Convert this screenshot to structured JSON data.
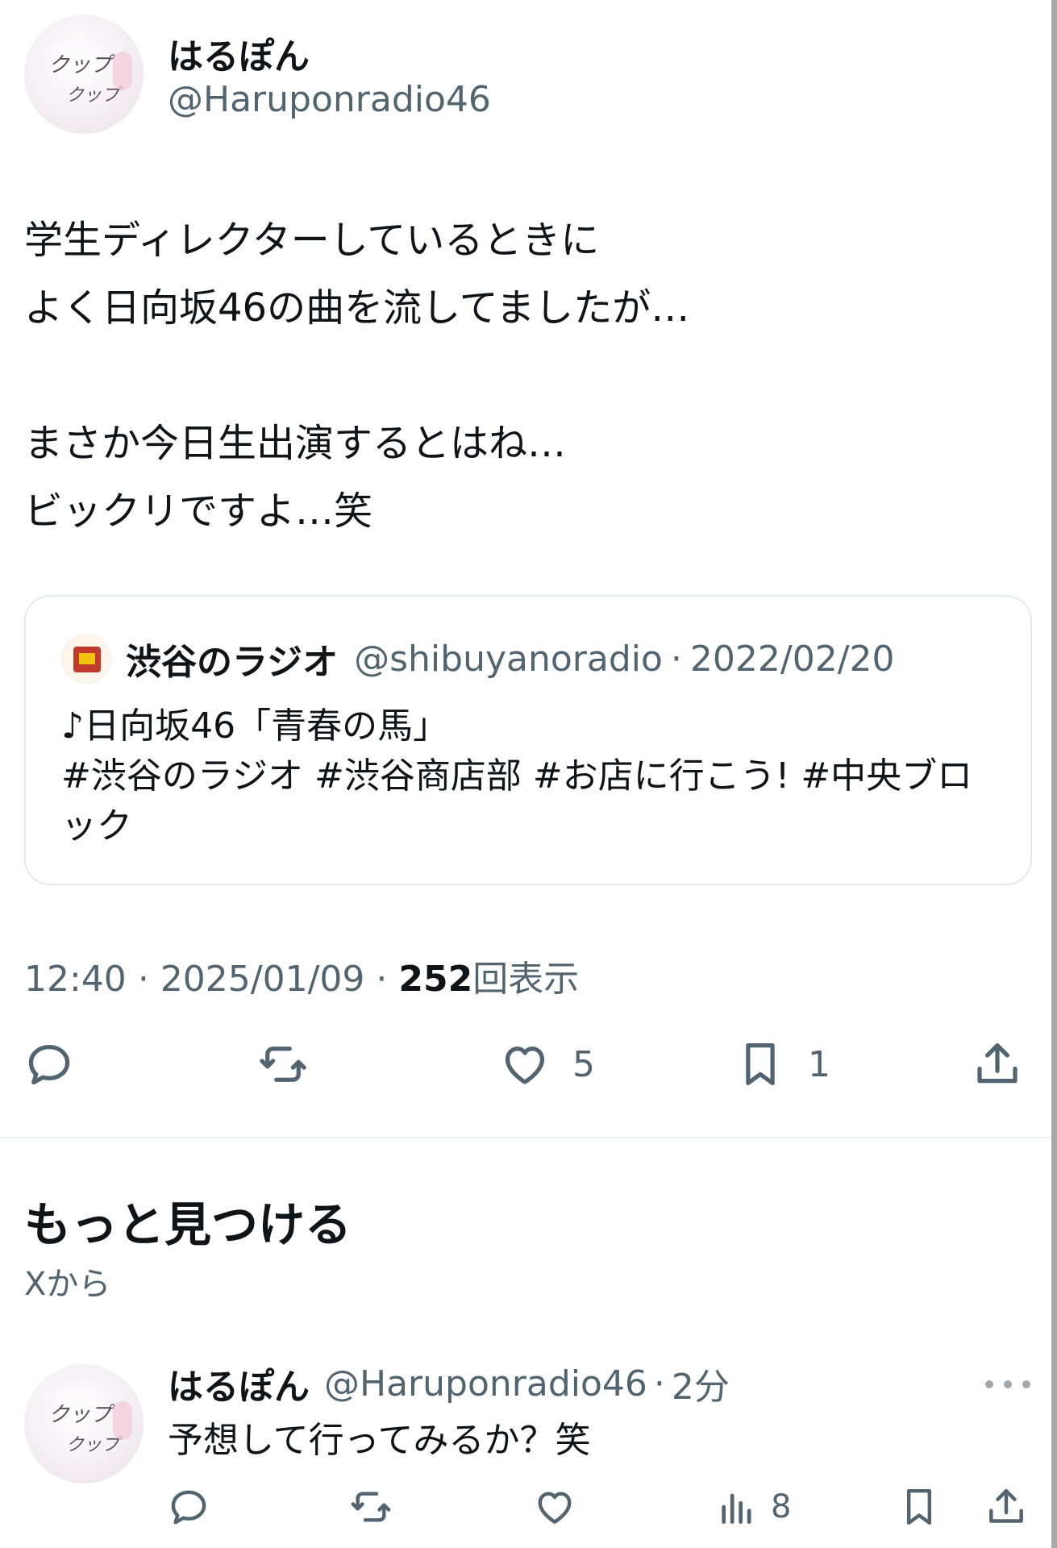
{
  "tweet": {
    "display_name": "はるぽん",
    "handle": "@Haruponradio46",
    "text_lines": [
      "学生ディレクターしているときに",
      "よく日向坂46の曲を流してましたが…",
      "",
      "まさか今日生出演するとはね…",
      "ビックリですよ…笑"
    ],
    "avatar_text": [
      "クップ",
      "クップ"
    ],
    "time": "12:40",
    "date": "2025/01/09",
    "views_count": "252",
    "views_label": "回表示",
    "separator": "·",
    "actions": {
      "reply_icon": "reply-icon",
      "retweet_icon": "retweet-icon",
      "like_icon": "heart-icon",
      "like_count": "5",
      "bookmark_icon": "bookmark-icon",
      "bookmark_count": "1",
      "share_icon": "share-icon"
    }
  },
  "quote": {
    "display_name": "渋谷のラジオ",
    "handle": "@shibuyanoradio",
    "date": "2022/02/20",
    "separator": "·",
    "text_lines": [
      "♪日向坂46「青春の馬」",
      "#渋谷のラジオ #渋谷商店部 #お店に行こう! #中央ブロ",
      "ック"
    ]
  },
  "discover": {
    "title": "もっと見つける",
    "subtitle": "Xから"
  },
  "reply": {
    "display_name": "はるぽん",
    "handle": "@Haruponradio46",
    "separator": "·",
    "time_ago": "2分",
    "text": "予想して行ってみるか？笑",
    "views_count": "8"
  },
  "colors": {
    "text_primary": "#0f1419",
    "text_secondary": "#536471",
    "border": "#e6e9eb"
  }
}
